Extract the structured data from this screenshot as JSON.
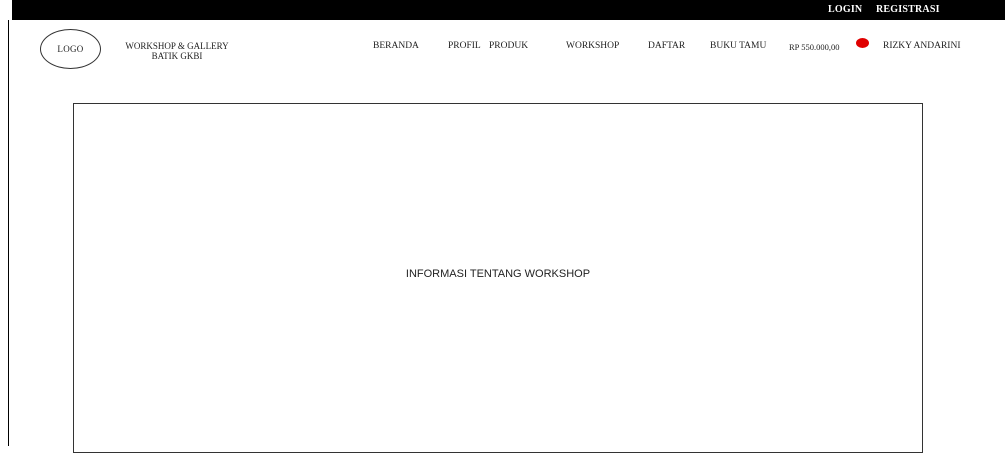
{
  "topbar": {
    "login_label": "LOGIN",
    "register_label": "REGISTRASI"
  },
  "header": {
    "logo_text": "LOGO",
    "brand_line1": "WORKSHOP & GALLERY",
    "brand_line2": "BATIK GKBI"
  },
  "nav": {
    "items": [
      "BERANDA",
      "PROFIL",
      "PRODUK",
      "WORKSHOP",
      "DAFTAR",
      "BUKU TAMU"
    ],
    "cart_total": "RP 550.000,00",
    "user_name": "RIZKY ANDARINI"
  },
  "main": {
    "content_text": "INFORMASI TENTANG WORKSHOP"
  },
  "colors": {
    "topbar_bg": "#000000",
    "cart_badge": "#e00000"
  }
}
